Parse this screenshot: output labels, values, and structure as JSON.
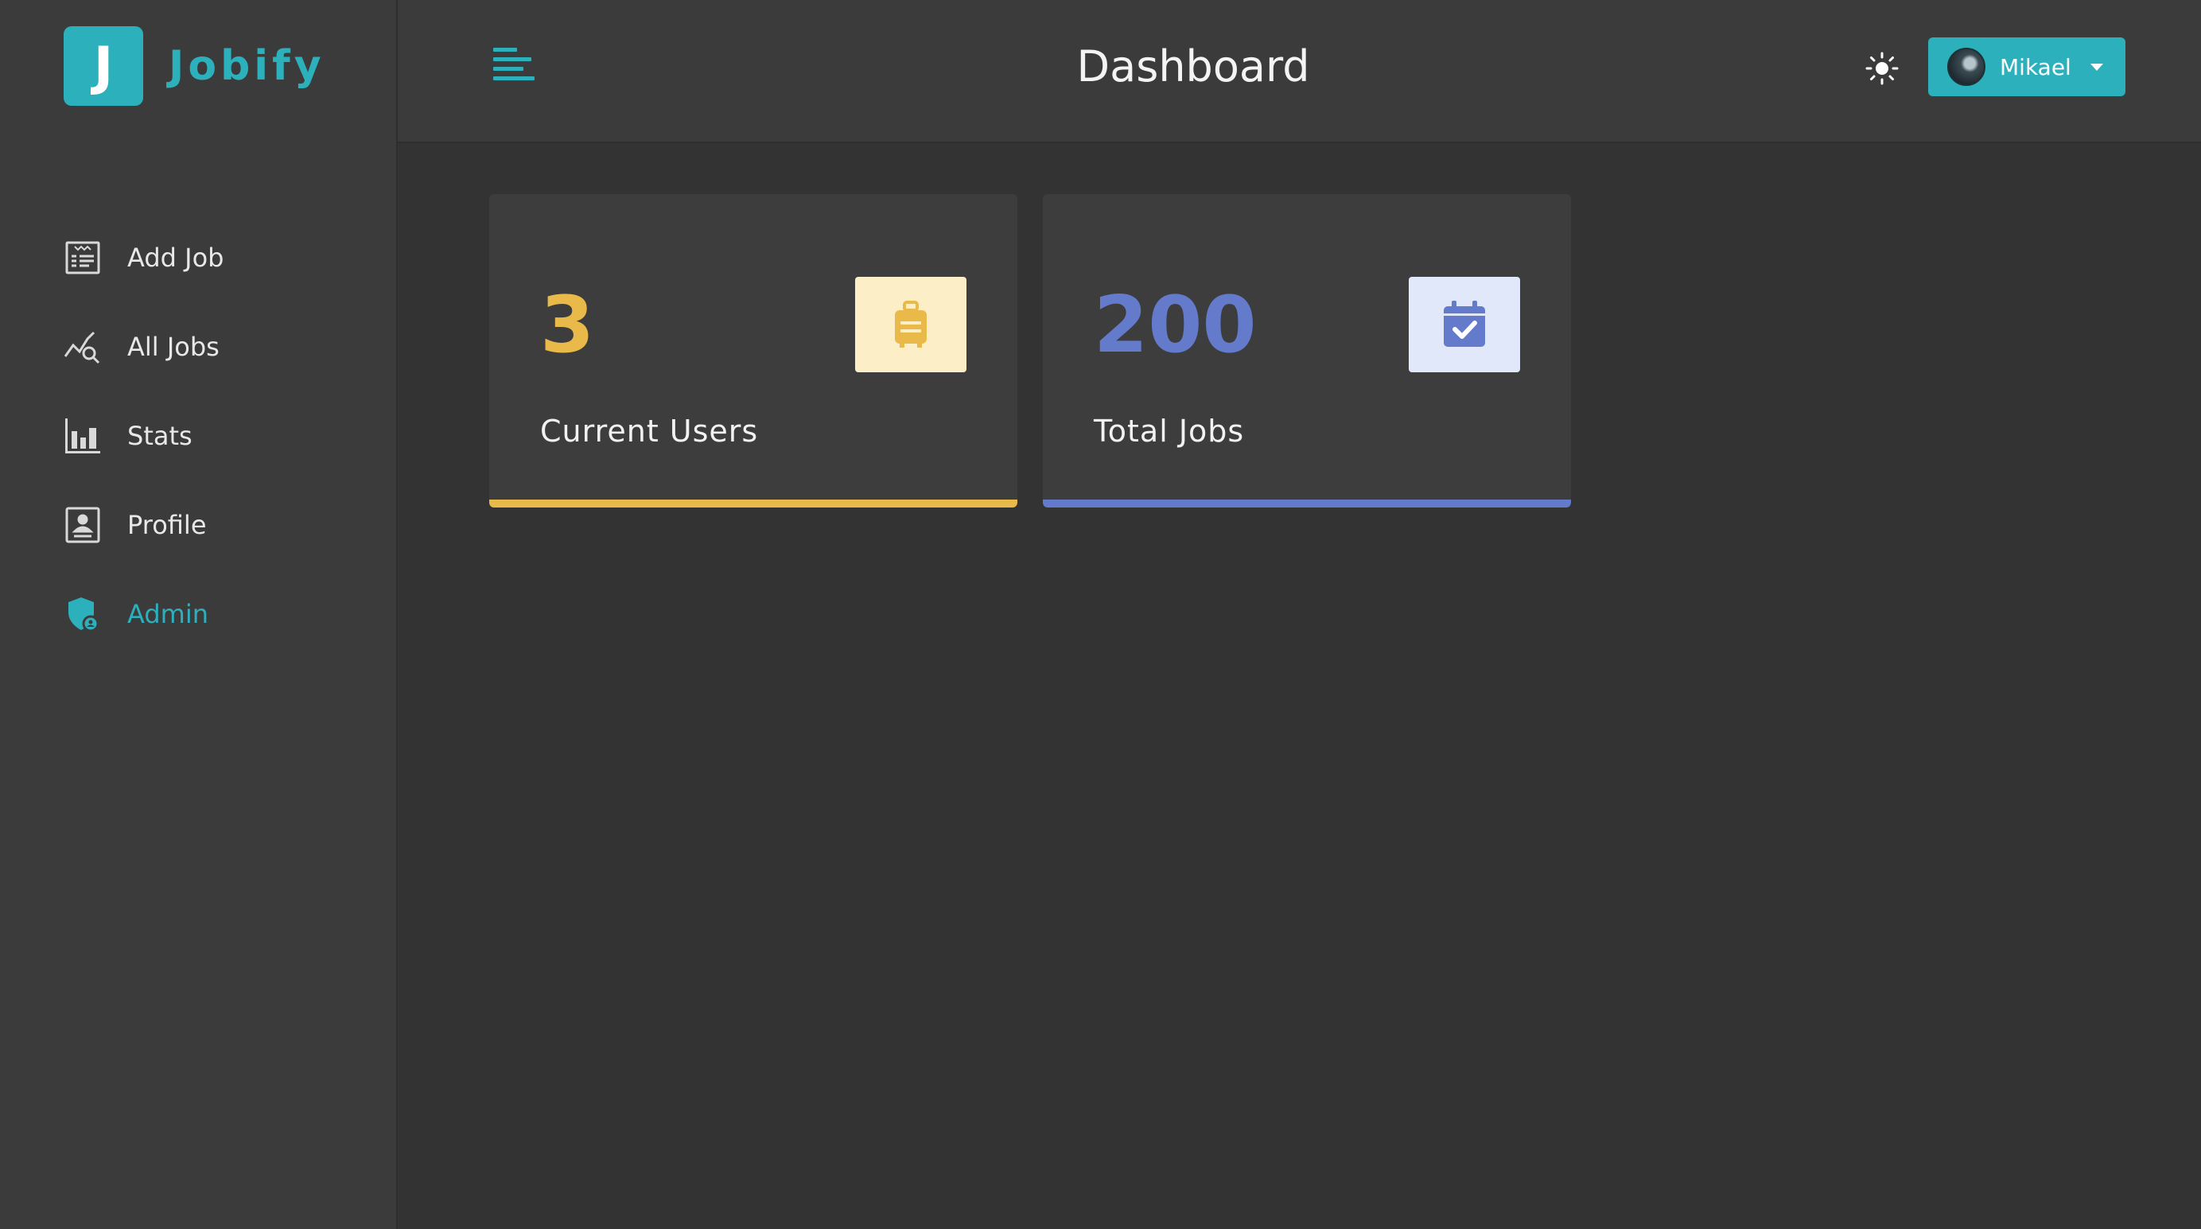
{
  "app": {
    "logo_letter": "J",
    "logo_text": "Jobify",
    "accent_color": "#2cb1bc"
  },
  "sidebar": {
    "items": [
      {
        "label": "Add Job",
        "icon": "form-icon",
        "active": false
      },
      {
        "label": "All Jobs",
        "icon": "chart-search-icon",
        "active": false
      },
      {
        "label": "Stats",
        "icon": "bar-chart-icon",
        "active": false
      },
      {
        "label": "Profile",
        "icon": "profile-card-icon",
        "active": false
      },
      {
        "label": "Admin",
        "icon": "admin-shield-icon",
        "active": true
      }
    ]
  },
  "header": {
    "title": "Dashboard",
    "theme_icon": "sun-icon",
    "user": {
      "name": "Mikael"
    }
  },
  "stats": [
    {
      "count": "3",
      "label": "Current Users",
      "color": "#e9b949",
      "icon_bg": "#fcefc7",
      "icon": "suitcase-icon"
    },
    {
      "count": "200",
      "label": "Total Jobs",
      "color": "#647acb",
      "icon_bg": "#e0e8f9",
      "icon": "calendar-check-icon"
    }
  ]
}
